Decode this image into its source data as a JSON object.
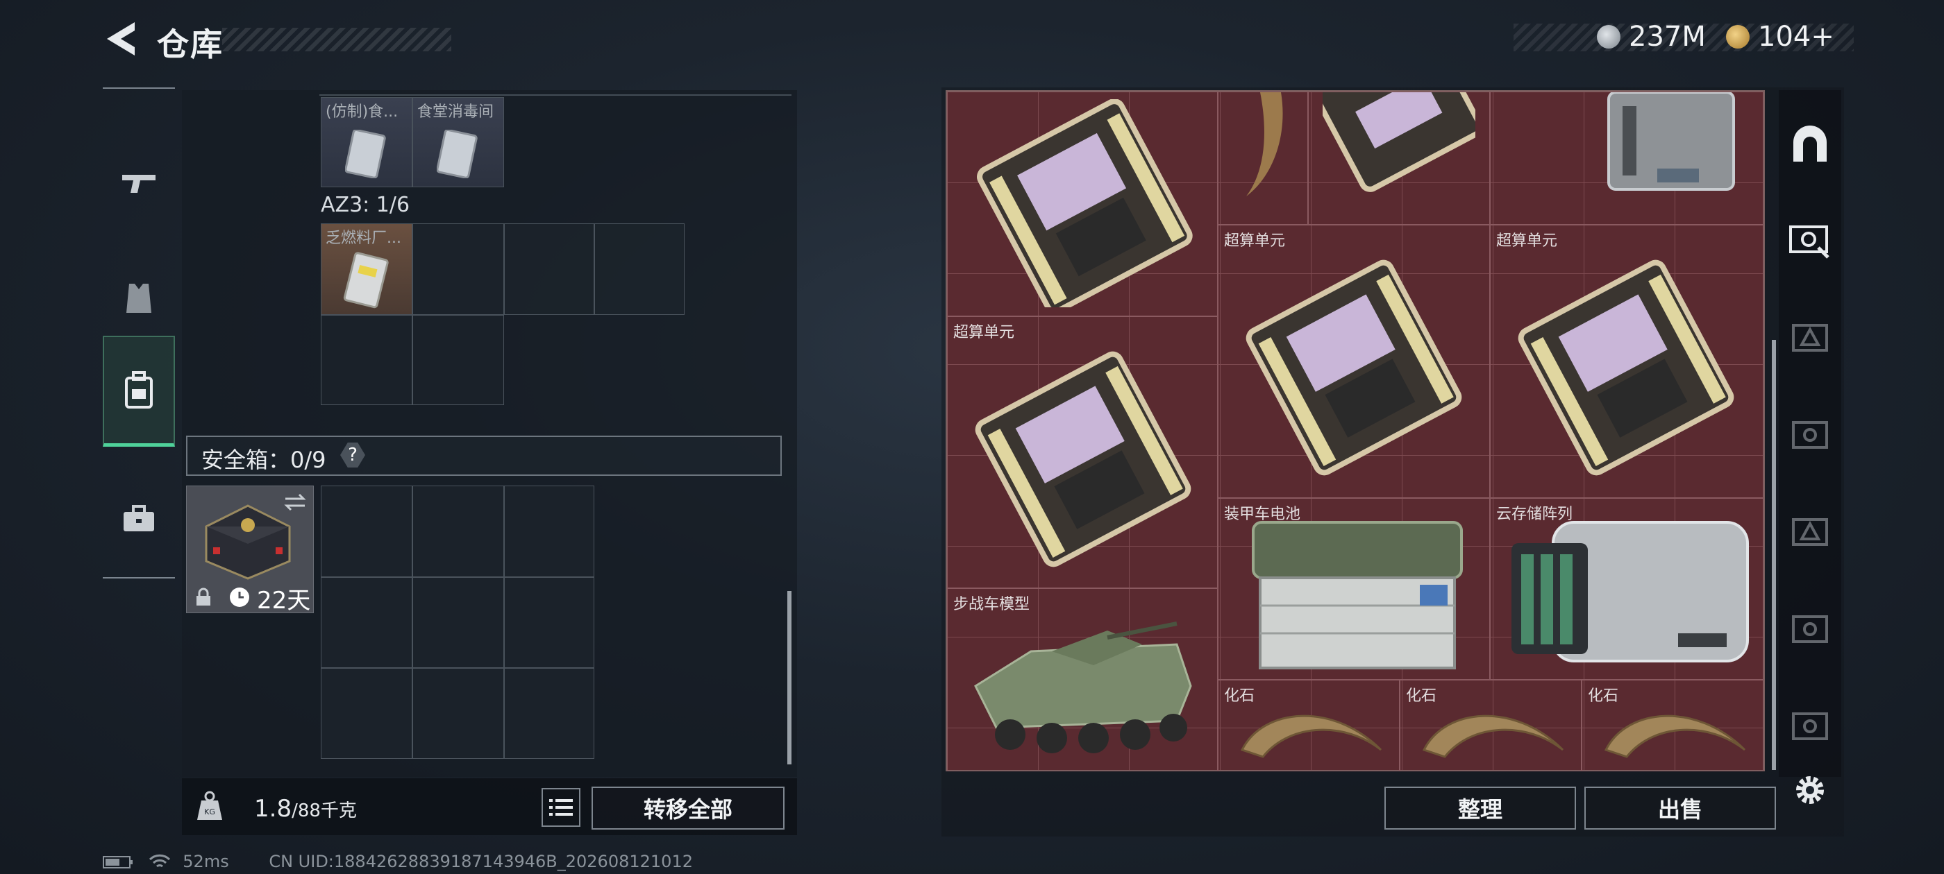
{
  "header": {
    "title": "仓库"
  },
  "currency": {
    "silver": "237M",
    "gold": "104+"
  },
  "sidebar": {
    "items": [
      "gun-icon",
      "vest-icon",
      "backpack-icon",
      "case-icon"
    ]
  },
  "left": {
    "small_items": [
      "(仿制)食...",
      "食堂消毒间"
    ],
    "az3_label": "AZ3: 1/6",
    "az3_item": "乏燃料厂...",
    "safe_box": {
      "label": "安全箱：0/9",
      "help": "?",
      "days": "22天"
    },
    "weight": {
      "current": "1.8",
      "max": "/88千克"
    },
    "transfer_all": "转移全部"
  },
  "right": {
    "items": {
      "c1": "超算单元",
      "c2": "超算单元",
      "c3": "超算单元",
      "battery": "装甲车电池",
      "storage": "云存储阵列",
      "ifv": "步战车模型",
      "f1": "化石",
      "f2": "化石",
      "f3": "化石"
    },
    "sort": "整理",
    "sell": "出售"
  },
  "status": {
    "ping": "52ms",
    "uid": "CN UID:18842628839187143946B_202608121012"
  }
}
